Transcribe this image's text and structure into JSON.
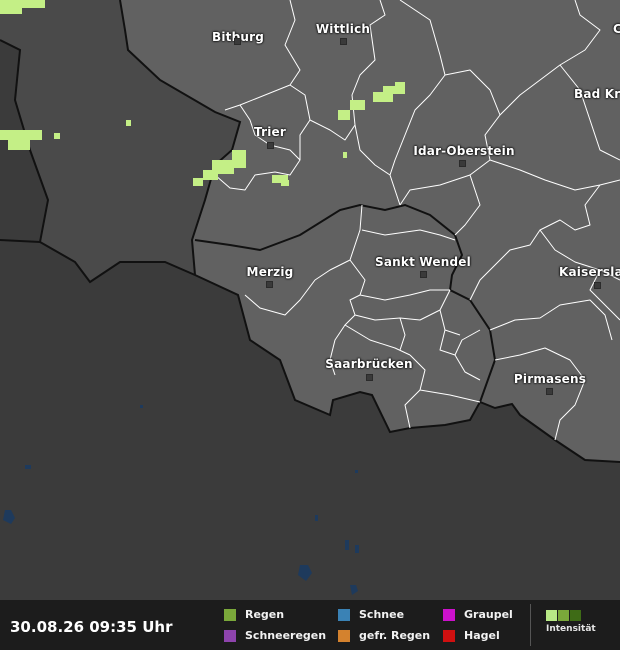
{
  "map": {
    "colors": {
      "background": "#3b3b3b",
      "region": "#616161",
      "outside": "#3b3b3b",
      "rain": "#c4ef86",
      "water": "#1e3a5c"
    },
    "cities": [
      {
        "name": "Bitburg"
      },
      {
        "name": "Wittlich"
      },
      {
        "name": "Bad Kr"
      },
      {
        "name": "Trier"
      },
      {
        "name": "Idar-Oberstein"
      },
      {
        "name": "Merzig"
      },
      {
        "name": "Sankt Wendel"
      },
      {
        "name": "Kaiserslau"
      },
      {
        "name": "Saarbrücken"
      },
      {
        "name": "Pirmasens"
      },
      {
        "name": "C"
      }
    ]
  },
  "footer": {
    "timestamp": "30.08.26 09:35 Uhr",
    "legend": [
      {
        "label": "Regen",
        "color": "#7aa83a",
        "icon": "rain-swatch"
      },
      {
        "label": "Schneeregen",
        "color": "#8e44ad",
        "icon": "sleet-swatch"
      },
      {
        "label": "Schnee",
        "color": "#3a82b5",
        "icon": "snow-swatch"
      },
      {
        "label": "gefr. Regen",
        "color": "#d4822e",
        "icon": "freezing-rain-swatch"
      },
      {
        "label": "Graupel",
        "color": "#cc11cc",
        "icon": "graupel-swatch"
      },
      {
        "label": "Hagel",
        "color": "#d01010",
        "icon": "hail-swatch"
      }
    ],
    "intensity": {
      "label": "Intensität",
      "colors": [
        "#b8e986",
        "#7aa83a",
        "#3e6b16"
      ]
    }
  }
}
